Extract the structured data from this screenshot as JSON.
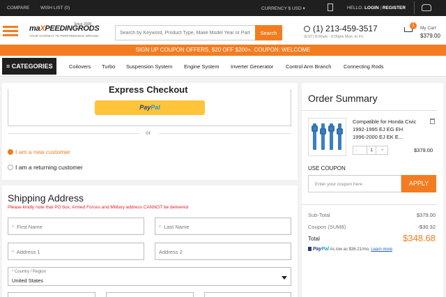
{
  "topbar": {
    "compare": "COMPARE",
    "wishlist": "WISH LIST (0)",
    "currency": "CURRENCY  $ USD ▾",
    "hello": "HELLO.",
    "login": "LOGIN",
    "divider": "|",
    "register": "REGISTER"
  },
  "header": {
    "logo_main_1": "ma",
    "logo_main_2": "X",
    "logo_main_3": "PEEDINGRODS",
    "logo_since": "Since 2008",
    "logo_tagline": "YOUR GATEWAY TO PERFORMANCE DRIVING",
    "search_placeholder": "Search by Keyword, Product Type, Make Model Year or Part",
    "search_button": "Search",
    "phone": "(1) 213-459-3517",
    "hours": "(EST) 8:00am - 6:00pm Mon. to Fri.",
    "cart_count": "1",
    "cart_label": "My Cart",
    "cart_total": "$379.00"
  },
  "promo": "SIGN UP COUPON OFFERS, $20 OFF $200+. COUPON: WELCOME",
  "nav": {
    "categories": "CATEGORIES",
    "items": [
      "Coilovers",
      "Turbo",
      "Suspension System",
      "Engine System",
      "Inverter Generator",
      "Control Arm Branch",
      "Connecting Rods"
    ]
  },
  "checkout": {
    "express_title": "Express Checkout",
    "paypal_pay": "Pay",
    "paypal_pal": "Pal",
    "or": "or",
    "new_customer": "I am a new customer",
    "returning_customer": "I am a returning customer"
  },
  "shipping": {
    "title": "Shipping Address",
    "note": "Please kindly note that PO box, Armed Forces and Military address CANNOT be delivered",
    "required_mark": "*",
    "first_name": "First Name",
    "last_name": "Last Name",
    "address1": "Address 1",
    "address2": "Address 2",
    "country_label": "Country / Region",
    "country_value": "United States"
  },
  "summary": {
    "title": "Order Summary",
    "product_name": "Compatible for Honda Civic 1992-1995 EJ EG EH 1996-2000 EJ EK E...",
    "qty_minus": "-",
    "qty": "1",
    "qty_plus": "+",
    "product_price": "$379.00",
    "coupon_label": "USE COUPON",
    "coupon_placeholder": "Enter your coupon here",
    "apply": "APPLY",
    "subtotal_label": "Sub-Total",
    "subtotal": "$379.00",
    "coupon_row_label": "Coupon (SUM8)",
    "coupon_value": "-$30.32",
    "total_label": "Total",
    "total": "$348.68",
    "paypal_pay": "Pay",
    "paypal_pal": "Pal",
    "paypal_text": "As low as $36.21/mo.",
    "learn_more": "Learn more"
  },
  "colors": {
    "accent": "#f47c20",
    "dark": "#1f1f1f",
    "paypal_yellow": "#ffc439",
    "warning": "#e02020"
  }
}
